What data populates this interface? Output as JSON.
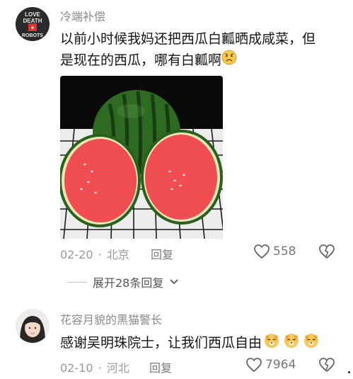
{
  "comments": [
    {
      "username": "冷端补偿",
      "avatar_logo": [
        "LOVE",
        "DEATH",
        "+",
        "ROBOTS"
      ],
      "text_line1": "以前小时候我妈还把西瓜白瓤晒成咸菜，但",
      "text_line2": "是现在的西瓜，哪有白瓤啊",
      "date": "02-20",
      "location": "北京",
      "reply_label": "回复",
      "likes": "558",
      "emoji": "worried-face",
      "image": "watermelon-halves-photo"
    },
    {
      "username": "花容月貌的黑猫警长",
      "text_line1": "感谢吴明珠院士，让我们西瓜自由",
      "date": "02-10",
      "location": "河北",
      "reply_label": "回复",
      "likes": "7964",
      "emoji": "dog-face"
    }
  ],
  "expand_replies": "展开28条回复",
  "separator": "·",
  "colors": {
    "meta_gray": "#9a9a9a",
    "username_gray": "#8a8a8a",
    "watermelon_red": "#ef4d52"
  }
}
